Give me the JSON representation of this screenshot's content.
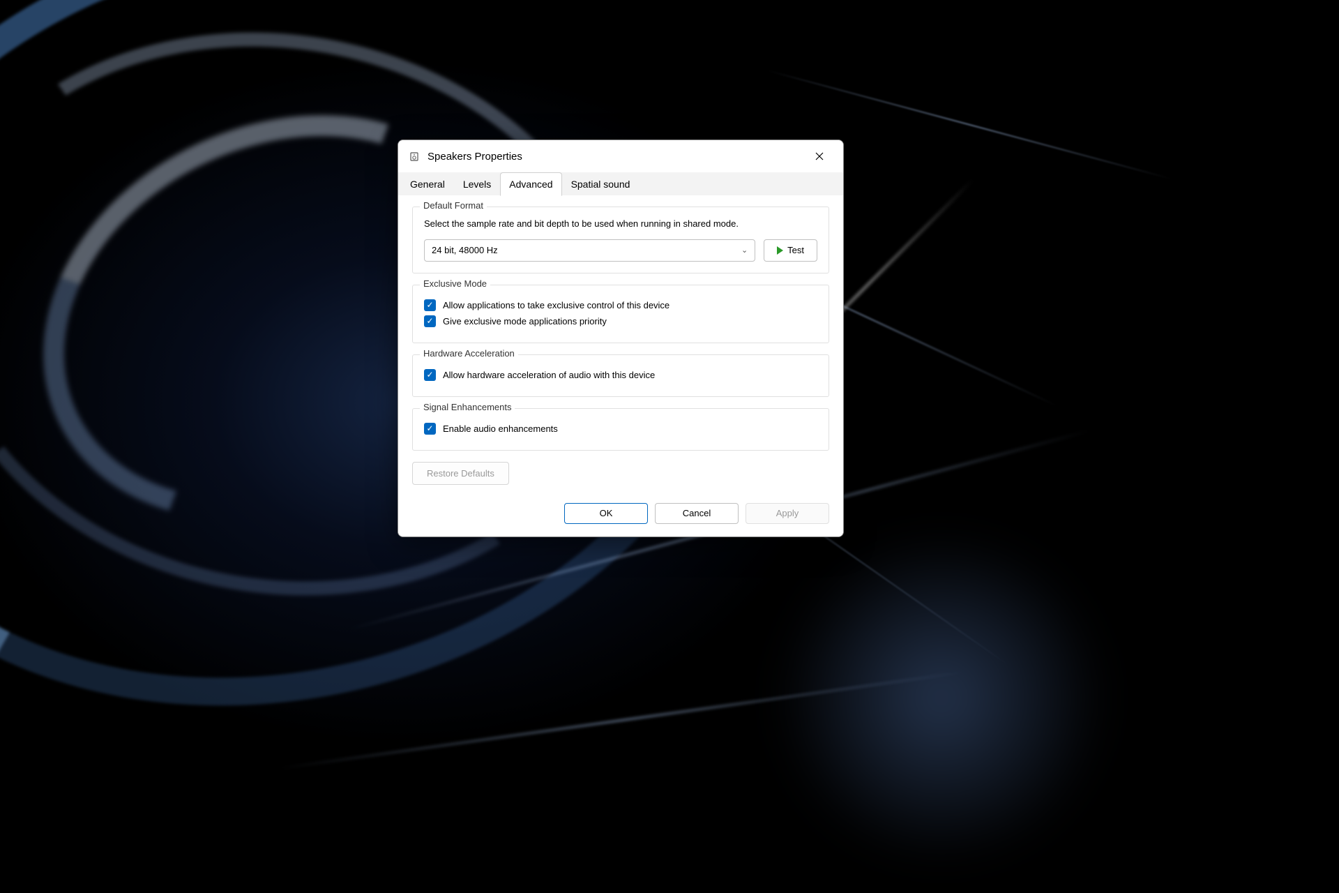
{
  "dialog": {
    "title": "Speakers Properties"
  },
  "tabs": {
    "general": "General",
    "levels": "Levels",
    "advanced": "Advanced",
    "spatial_sound": "Spatial sound"
  },
  "default_format": {
    "label": "Default Format",
    "description": "Select the sample rate and bit depth to be used when running in shared mode.",
    "selected": "24 bit, 48000 Hz",
    "test_button": "Test"
  },
  "exclusive_mode": {
    "label": "Exclusive Mode",
    "allow_exclusive": "Allow applications to take exclusive control of this device",
    "give_priority": "Give exclusive mode applications priority"
  },
  "hardware_acceleration": {
    "label": "Hardware Acceleration",
    "allow_hw": "Allow hardware acceleration of audio with this device"
  },
  "signal_enhancements": {
    "label": "Signal Enhancements",
    "enable_audio": "Enable audio enhancements"
  },
  "buttons": {
    "restore_defaults": "Restore Defaults",
    "ok": "OK",
    "cancel": "Cancel",
    "apply": "Apply"
  }
}
